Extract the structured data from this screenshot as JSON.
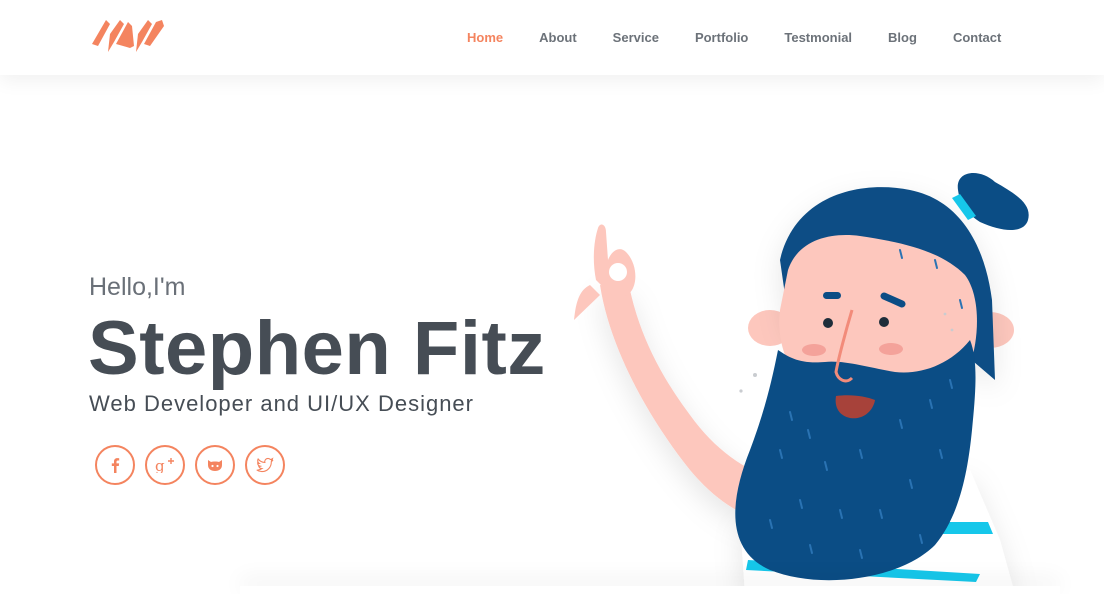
{
  "nav": {
    "logo_name": "brand-logo",
    "links": [
      {
        "label": "Home",
        "active": true
      },
      {
        "label": "About",
        "active": false
      },
      {
        "label": "Service",
        "active": false
      },
      {
        "label": "Portfolio",
        "active": false
      },
      {
        "label": "Testmonial",
        "active": false
      },
      {
        "label": "Blog",
        "active": false
      },
      {
        "label": "Contact",
        "active": false
      }
    ]
  },
  "hero": {
    "greeting": "Hello,I'm",
    "name": "Stephen Fitz",
    "role": "Web Developer and UI/UX Designer"
  },
  "socials": [
    {
      "icon": "facebook-icon"
    },
    {
      "icon": "google-plus-icon"
    },
    {
      "icon": "github-icon"
    },
    {
      "icon": "twitter-icon"
    }
  ],
  "colors": {
    "accent": "#f4845f",
    "text_dark": "#464d55",
    "text_muted": "#6c7279",
    "beard": "#0b4d85",
    "skin": "#fdc7bd",
    "stripe": "#16c7ea"
  }
}
